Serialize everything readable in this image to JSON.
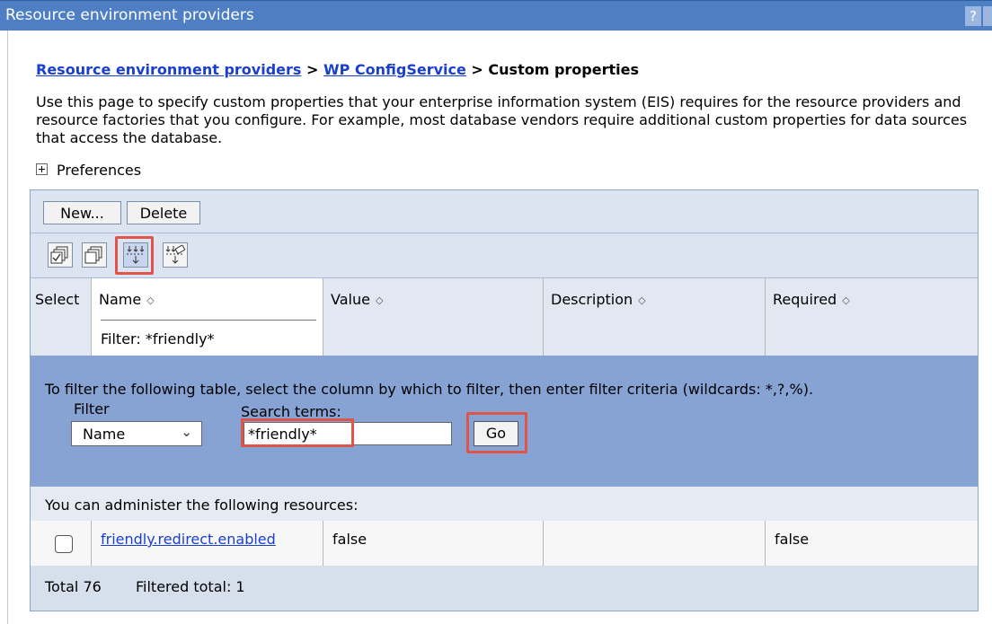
{
  "window": {
    "title": "Resource environment providers",
    "help_glyph": "?"
  },
  "breadcrumb": {
    "link1": "Resource environment providers",
    "sep1": " > ",
    "link2": "WP ConfigService",
    "sep2": " > ",
    "current": "Custom properties"
  },
  "description": "Use this page to specify custom properties that your enterprise information system (EIS) requires for the resource providers and resource factories that you configure. For example, most database vendors require additional custom properties for data sources that access the database.",
  "preferences": {
    "label": "Preferences"
  },
  "toolbar": {
    "new_label": "New...",
    "delete_label": "Delete",
    "icons": [
      "select-all-icon",
      "deselect-all-icon",
      "show-filter-icon",
      "clear-filter-icon"
    ]
  },
  "table": {
    "headers": {
      "select": "Select",
      "name": "Name",
      "value": "Value",
      "description": "Description",
      "required": "Required"
    },
    "active_filter": "Filter: *friendly*",
    "sort_glyph": "◇"
  },
  "filter_panel": {
    "instruction": "To filter the following table, select the column by which to filter, then enter filter criteria (wildcards: *,?,%).",
    "filter_label": "Filter",
    "filter_selected": "Name",
    "search_label": "Search terms:",
    "search_value": "*friendly*",
    "go_label": "Go"
  },
  "admin_caption": "You can administer the following resources:",
  "rows": [
    {
      "name": "friendly.redirect.enabled",
      "value": "false",
      "description": "",
      "required": "false"
    }
  ],
  "footer": {
    "total": "Total 76",
    "filtered": "Filtered total: 1"
  },
  "colors": {
    "titlebar": "#4e7ec3",
    "filter_panel": "#86a3d4",
    "highlight": "#e0554a",
    "link": "#1a3fcf"
  }
}
